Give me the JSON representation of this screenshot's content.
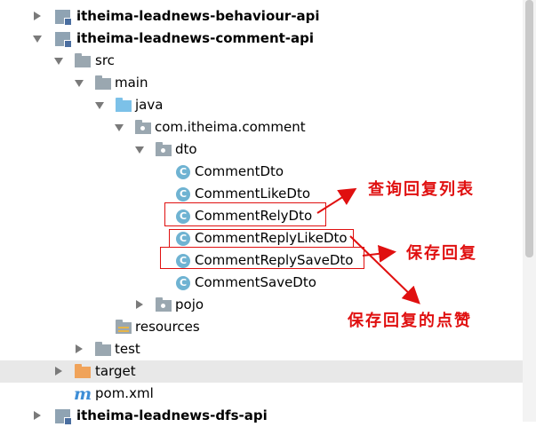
{
  "tree": {
    "module_above": "itheima-leadnews-behaviour-api",
    "module_open": "itheima-leadnews-comment-api",
    "src": "src",
    "main": "main",
    "java": "java",
    "package": "com.itheima.comment",
    "dto": "dto",
    "classes": [
      "CommentDto",
      "CommentLikeDto",
      "CommentRelyDto",
      "CommentReplyLikeDto",
      "CommentReplySaveDto",
      "CommentSaveDto"
    ],
    "class_icon_letter": "C",
    "pojo": "pojo",
    "resources": "resources",
    "test": "test",
    "target": "target",
    "pom": "pom.xml",
    "maven_icon_letter": "m",
    "module_below": "itheima-leadnews-dfs-api"
  },
  "annotations": {
    "query_reply": "查询回复列表",
    "save_reply": "保存回复",
    "save_reply_like": "保存回复的点赞"
  },
  "colors": {
    "annotation": "#e01010",
    "folder": "#9aa7b0",
    "source_folder": "#7cc1e8",
    "excluded_folder": "#f0a35a",
    "class_icon": "#6fb3d2"
  }
}
